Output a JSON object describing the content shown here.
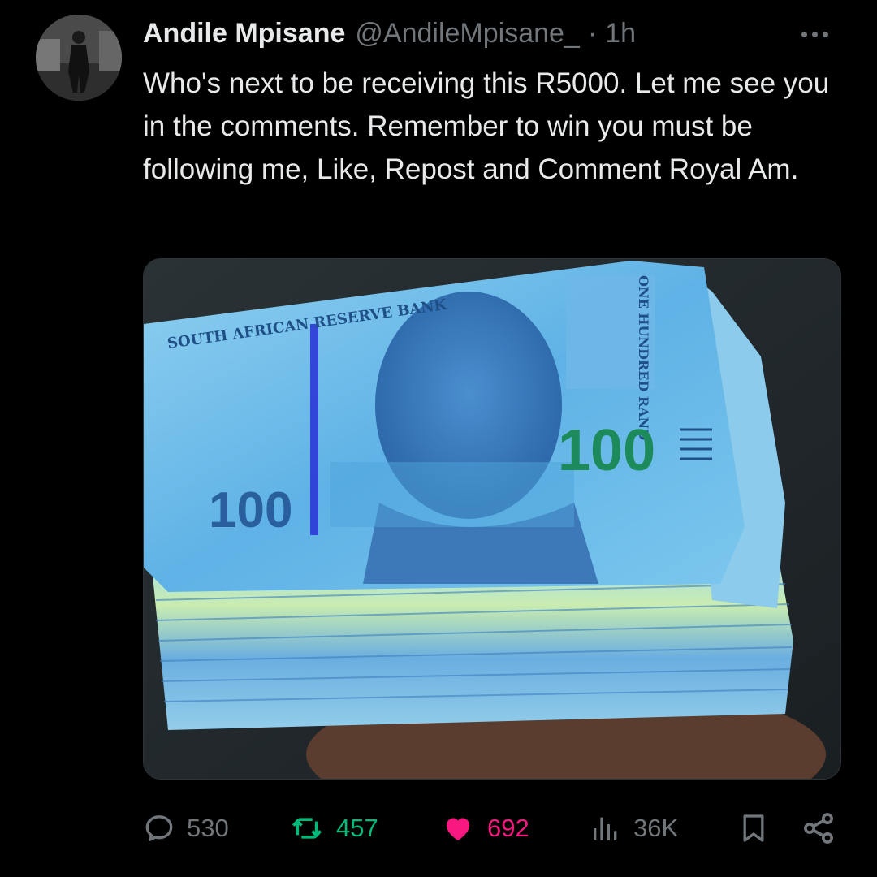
{
  "post": {
    "author_name": "Andile Mpisane",
    "handle": "@AndileMpisane_",
    "separator": "·",
    "time": "1h",
    "text": "Who's next to be receiving this R5000. Let me see you in the comments. Remember to win you must be following me, Like, Repost and Comment Royal Am."
  },
  "media": {
    "bank_name": "SOUTH AFRICAN RESERVE BANK",
    "denomination_words": "ONE HUNDRED RAND",
    "denomination_big": "100",
    "denomination_small": "100"
  },
  "actions": {
    "replies": "530",
    "reposts": "457",
    "likes": "692",
    "views": "36K"
  },
  "colors": {
    "background": "#000000",
    "text": "#e7e9ea",
    "secondary": "#71767b",
    "repost_active": "#00ba7c",
    "like_active": "#f91880"
  },
  "icons": [
    "more-icon",
    "reply-icon",
    "repost-icon",
    "like-icon",
    "views-icon",
    "bookmark-icon",
    "share-icon"
  ]
}
